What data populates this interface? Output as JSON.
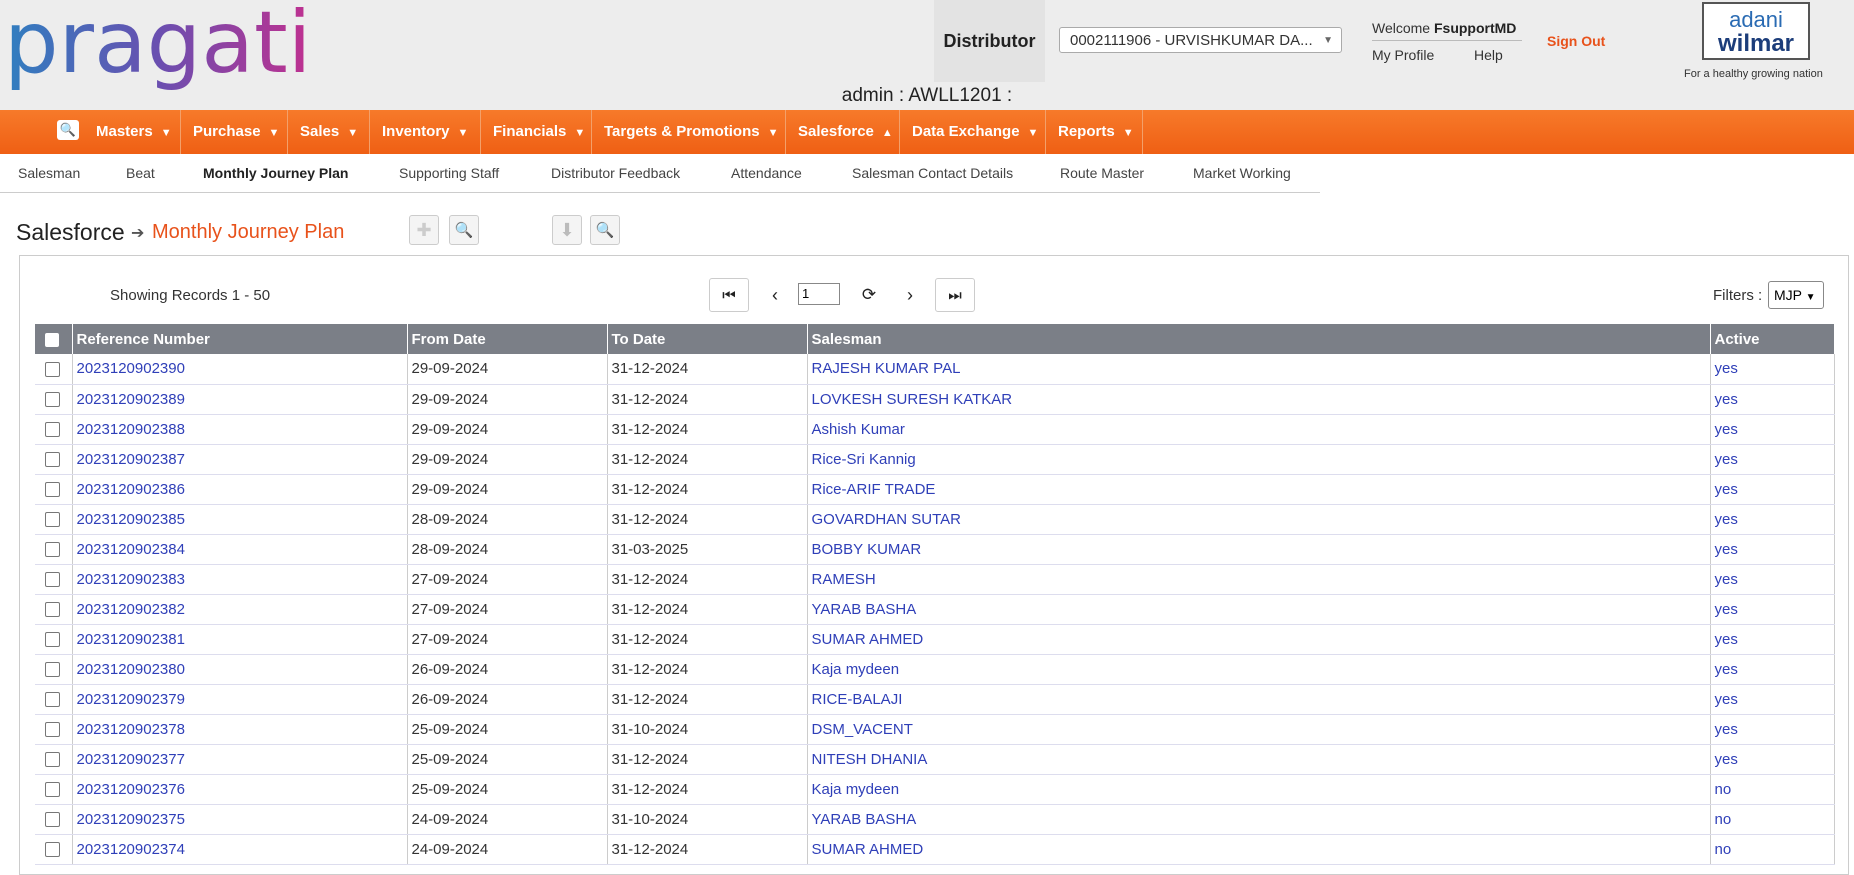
{
  "header": {
    "logo_text": "pragati",
    "distributor_label": "Distributor",
    "distributor_value": "0002111906 - URVISHKUMAR DA...",
    "welcome_prefix": "Welcome",
    "username": "FsupportMD",
    "my_profile": "My Profile",
    "help": "Help",
    "sign_out": "Sign Out",
    "brand_line1": "adani",
    "brand_line2": "wilmar",
    "brand_tagline": "For a healthy growing nation",
    "admin_text": "admin : AWLL1201 :"
  },
  "nav": {
    "items": [
      {
        "label": "Masters",
        "arrow": "▼"
      },
      {
        "label": "Purchase",
        "arrow": "▼"
      },
      {
        "label": "Sales",
        "arrow": "▼"
      },
      {
        "label": "Inventory",
        "arrow": "▼"
      },
      {
        "label": "Financials",
        "arrow": "▼"
      },
      {
        "label": "Targets & Promotions",
        "arrow": "▼"
      },
      {
        "label": "Salesforce",
        "arrow": "▲"
      },
      {
        "label": "Data Exchange",
        "arrow": "▼"
      },
      {
        "label": "Reports",
        "arrow": "▼"
      }
    ]
  },
  "subnav": {
    "items": [
      "Salesman",
      "Beat",
      "Monthly Journey Plan",
      "Supporting Staff",
      "Distributor Feedback",
      "Attendance",
      "Salesman Contact Details",
      "Route Master",
      "Market Working"
    ],
    "active": "Monthly Journey Plan"
  },
  "breadcrumb": {
    "section": "Salesforce",
    "page": "Monthly Journey Plan"
  },
  "pager": {
    "showing": "Showing Records 1 - 50",
    "page": "1",
    "filters_label": "Filters :",
    "filter_value": "MJP"
  },
  "table": {
    "headers": [
      "Reference Number",
      "From Date",
      "To Date",
      "Salesman",
      "Active"
    ],
    "rows": [
      [
        "2023120902390",
        "29-09-2024",
        "31-12-2024",
        "RAJESH KUMAR PAL",
        "yes"
      ],
      [
        "2023120902389",
        "29-09-2024",
        "31-12-2024",
        "LOVKESH SURESH KATKAR",
        "yes"
      ],
      [
        "2023120902388",
        "29-09-2024",
        "31-12-2024",
        "Ashish Kumar",
        "yes"
      ],
      [
        "2023120902387",
        "29-09-2024",
        "31-12-2024",
        "Rice-Sri Kannig",
        "yes"
      ],
      [
        "2023120902386",
        "29-09-2024",
        "31-12-2024",
        "Rice-ARIF TRADE",
        "yes"
      ],
      [
        "2023120902385",
        "28-09-2024",
        "31-12-2024",
        "GOVARDHAN SUTAR",
        "yes"
      ],
      [
        "2023120902384",
        "28-09-2024",
        "31-03-2025",
        "BOBBY KUMAR",
        "yes"
      ],
      [
        "2023120902383",
        "27-09-2024",
        "31-12-2024",
        "RAMESH",
        "yes"
      ],
      [
        "2023120902382",
        "27-09-2024",
        "31-12-2024",
        "YARAB BASHA",
        "yes"
      ],
      [
        "2023120902381",
        "27-09-2024",
        "31-12-2024",
        "SUMAR AHMED",
        "yes"
      ],
      [
        "2023120902380",
        "26-09-2024",
        "31-12-2024",
        "Kaja mydeen",
        "yes"
      ],
      [
        "2023120902379",
        "26-09-2024",
        "31-12-2024",
        "RICE-BALAJI",
        "yes"
      ],
      [
        "2023120902378",
        "25-09-2024",
        "31-10-2024",
        "DSM_VACENT",
        "yes"
      ],
      [
        "2023120902377",
        "25-09-2024",
        "31-12-2024",
        "NITESH DHANIA",
        "yes"
      ],
      [
        "2023120902376",
        "25-09-2024",
        "31-12-2024",
        "Kaja mydeen",
        "no"
      ],
      [
        "2023120902375",
        "24-09-2024",
        "31-10-2024",
        "YARAB BASHA",
        "no"
      ],
      [
        "2023120902374",
        "24-09-2024",
        "31-12-2024",
        "SUMAR AHMED",
        "no"
      ]
    ]
  },
  "colors": {
    "accent": "#f06a1e",
    "link": "#2f3fb8",
    "header_bg": "#7b7f87"
  }
}
